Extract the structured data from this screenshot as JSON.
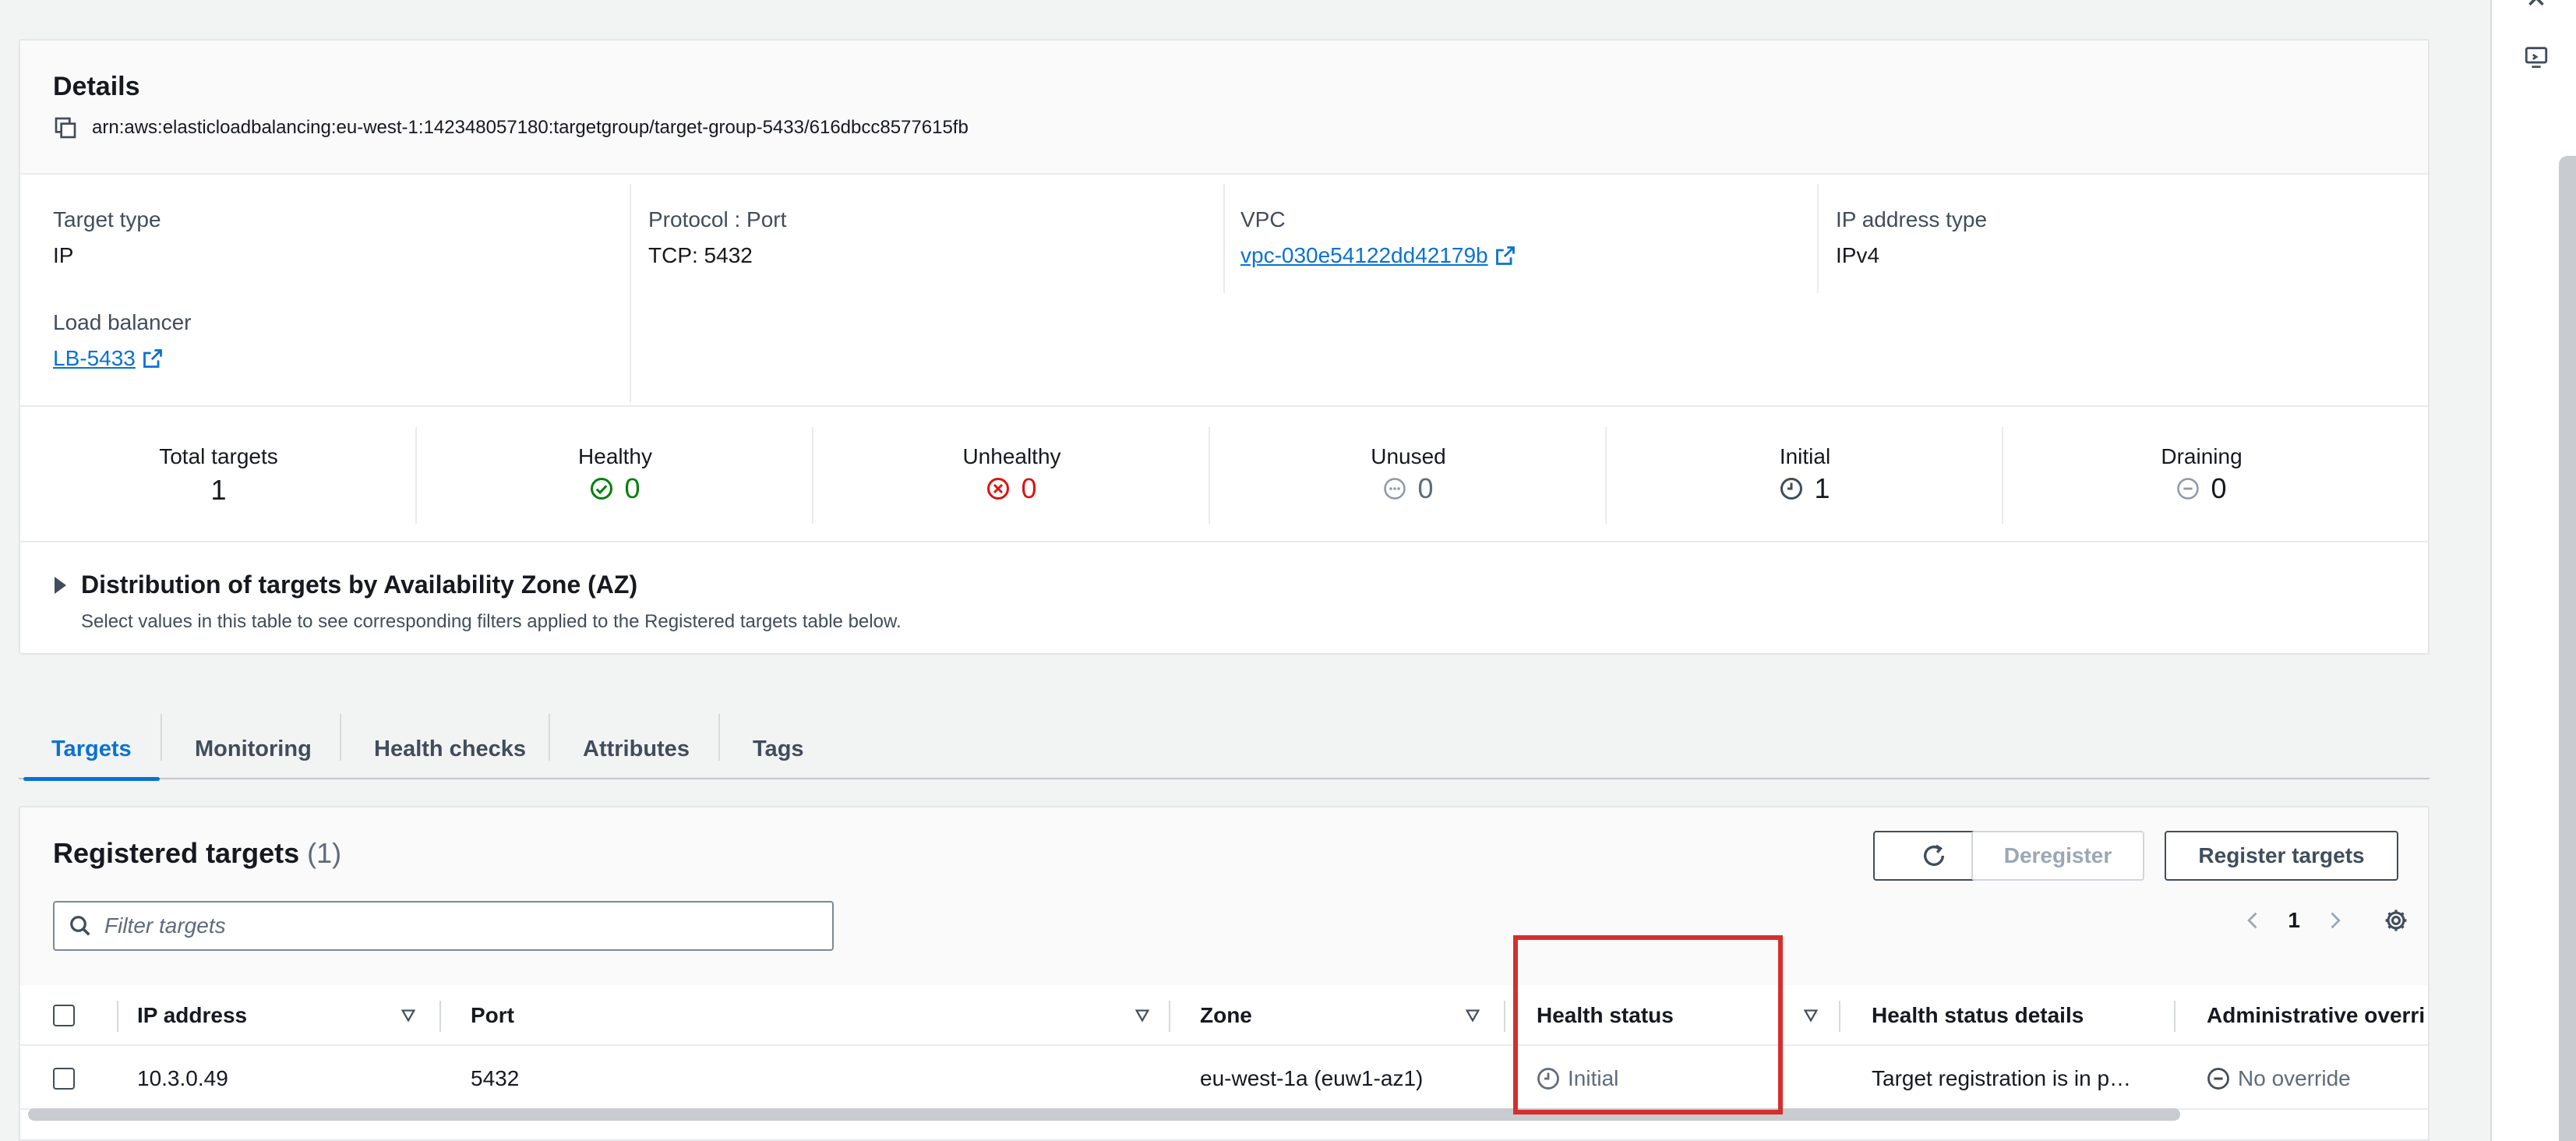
{
  "details": {
    "title": "Details",
    "arn": "arn:aws:elasticloadbalancing:eu-west-1:142348057180:targetgroup/target-group-5433/616dbcc8577615fb",
    "target_type_label": "Target type",
    "target_type_value": "IP",
    "protocol_port_label": "Protocol : Port",
    "protocol_port_value": "TCP: 5432",
    "vpc_label": "VPC",
    "vpc_value": "vpc-030e54122dd42179b",
    "ip_type_label": "IP address type",
    "ip_type_value": "IPv4",
    "lb_label": "Load balancer",
    "lb_value": "LB-5433"
  },
  "counts": [
    {
      "label": "Total targets",
      "value": "1",
      "status": "none",
      "color": "#16191f"
    },
    {
      "label": "Healthy",
      "value": "0",
      "status": "healthy",
      "color": "#037f0c"
    },
    {
      "label": "Unhealthy",
      "value": "0",
      "status": "unhealthy",
      "color": "#d91515"
    },
    {
      "label": "Unused",
      "value": "0",
      "status": "unused",
      "color": "#5f6b7a"
    },
    {
      "label": "Initial",
      "value": "1",
      "status": "initial",
      "color": "#16191f"
    },
    {
      "label": "Draining",
      "value": "0",
      "status": "draining",
      "color": "#16191f"
    }
  ],
  "az": {
    "title": "Distribution of targets by Availability Zone (AZ)",
    "description": "Select values in this table to see corresponding filters applied to the Registered targets table below."
  },
  "tabs": [
    "Targets",
    "Monitoring",
    "Health checks",
    "Attributes",
    "Tags"
  ],
  "registered": {
    "title": "Registered targets",
    "count": "(1)",
    "deregister_label": "Deregister",
    "register_label": "Register targets",
    "filter_placeholder": "Filter targets",
    "page": "1",
    "columns": {
      "ip": "IP address",
      "port": "Port",
      "zone": "Zone",
      "health": "Health status",
      "health_details": "Health status details",
      "admin": "Administrative overri"
    },
    "rows": [
      {
        "ip": "10.3.0.49",
        "port": "5432",
        "zone": "eu-west-1a (euw1-az1)",
        "health": "Initial",
        "health_details": "Target registration is in p…",
        "admin": "No override"
      }
    ]
  },
  "colors": {
    "link": "#0972d3",
    "healthy": "#037f0c",
    "unhealthy": "#d91515",
    "highlight": "#d32f2f"
  }
}
